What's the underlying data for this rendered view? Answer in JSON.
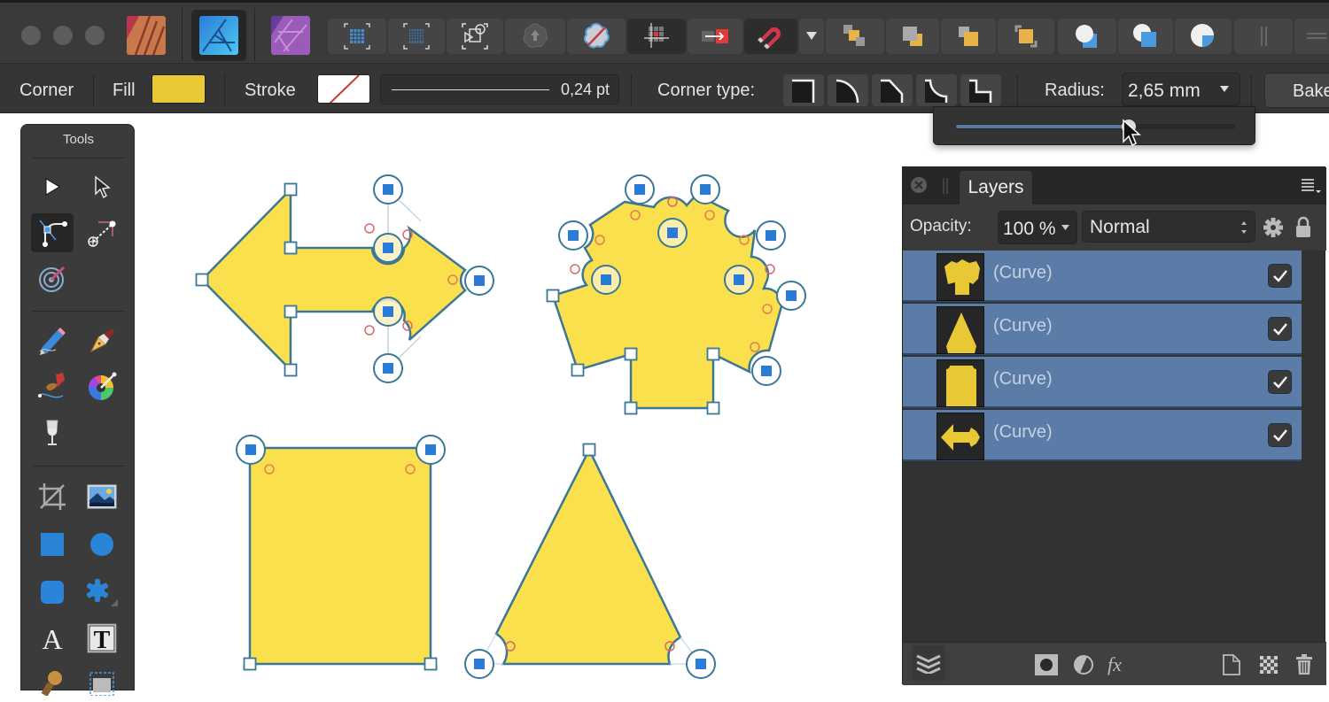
{
  "window": {
    "traffic_lights": [
      "close",
      "minimize",
      "zoom"
    ],
    "personas": [
      {
        "name": "publisher-persona",
        "selected": false
      },
      {
        "name": "designer-persona",
        "selected": true
      },
      {
        "name": "photo-persona",
        "selected": false
      }
    ]
  },
  "toolbar": {
    "buttons": [
      "snap-to-pixel-grid-icon",
      "snap-to-grid-icon",
      "transform-objects-icon",
      "boolean-add-icon",
      "boolean-no-fill-icon",
      "grid-snap-icon",
      "move-to-icon",
      "snapping-magnet-icon",
      "snapping-menu-icon",
      "arrange-back-icon",
      "arrange-backward-icon",
      "arrange-forward-icon",
      "arrange-front-icon",
      "geometry-add-icon",
      "geometry-subtract-icon",
      "geometry-intersect-icon",
      "align-center-icon",
      "align-middle-icon"
    ],
    "snapping_active": true
  },
  "context": {
    "tool_name": "Corner",
    "fill_label": "Fill",
    "fill_color": "#e8c935",
    "stroke_label": "Stroke",
    "stroke_color": "none",
    "stroke_width": "0,24 pt",
    "corner_type_label": "Corner type:",
    "corner_types": [
      "rounded",
      "concave",
      "straight",
      "inverted",
      "stepped"
    ],
    "radius_label": "Radius:",
    "radius_value": "2,65 mm",
    "bake_label": "Bake"
  },
  "radius_slider": {
    "value_fraction": 0.62
  },
  "tools": {
    "title": "Tools",
    "items": [
      "move-tool",
      "node-tool",
      "corner-tool",
      "point-transform-tool",
      "contextual-tool",
      "pencil-tool",
      "pen-tool",
      "vector-brush-tool",
      "color-picker-tool",
      "fill-tool",
      "crop-tool",
      "place-image-tool",
      "rectangle-tool",
      "ellipse-tool",
      "rounded-rectangle-tool",
      "shape-tool",
      "artistic-text-tool",
      "frame-text-tool",
      "fill-brush-tool",
      "table-tool"
    ],
    "active": "corner-tool"
  },
  "canvas": {
    "shape_fill": "#fbe04e",
    "shape_stroke": "#3b7796",
    "shapes": [
      "arrow-shape",
      "tree-shape",
      "rectangle-shape",
      "triangle-shape"
    ]
  },
  "layers": {
    "tab_label": "Layers",
    "opacity_label": "Opacity:",
    "opacity_value": "100 %",
    "blend_mode": "Normal",
    "rows": [
      {
        "name": "(Curve)",
        "thumb": "tree",
        "visible": true
      },
      {
        "name": "(Curve)",
        "thumb": "triangle",
        "visible": true
      },
      {
        "name": "(Curve)",
        "thumb": "rectangle",
        "visible": true
      },
      {
        "name": "(Curve)",
        "thumb": "arrow",
        "visible": true
      }
    ]
  }
}
